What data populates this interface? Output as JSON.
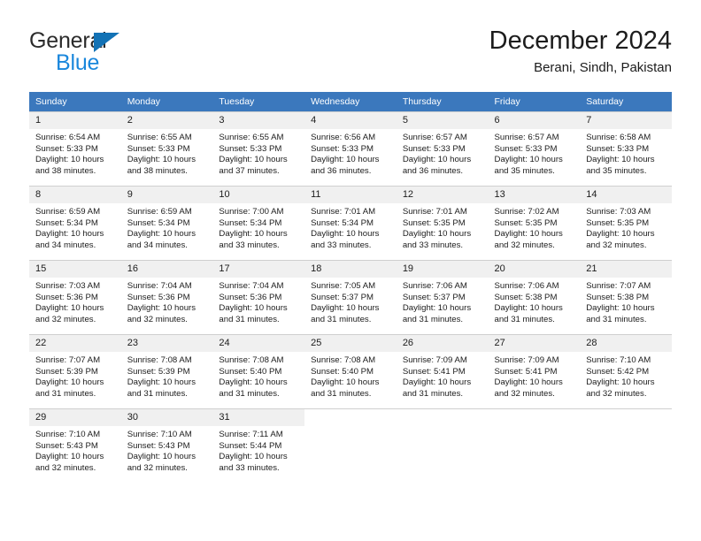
{
  "brand": {
    "name_top": "General",
    "name_bottom": "Blue",
    "triangle_icon": "brand-triangle-icon",
    "accent_color": "#1272b5",
    "blue_text_color": "#1a87dc"
  },
  "header": {
    "title": "December 2024",
    "subtitle": "Berani, Sindh, Pakistan"
  },
  "theme": {
    "header_row_background": "#3b78bd",
    "header_row_text": "#ffffff",
    "daynum_background": "#f0f0f0",
    "cell_border": "#cfcfcf",
    "body_text": "#1c1c1c"
  },
  "weekday_headers": [
    "Sunday",
    "Monday",
    "Tuesday",
    "Wednesday",
    "Thursday",
    "Friday",
    "Saturday"
  ],
  "labels": {
    "sunrise_prefix": "Sunrise:",
    "sunset_prefix": "Sunset:",
    "daylight_prefix": "Daylight:"
  },
  "weeks": [
    [
      {
        "day": "1",
        "sunrise": "Sunrise: 6:54 AM",
        "sunset": "Sunset: 5:33 PM",
        "daylight_1": "Daylight: 10 hours",
        "daylight_2": "and 38 minutes."
      },
      {
        "day": "2",
        "sunrise": "Sunrise: 6:55 AM",
        "sunset": "Sunset: 5:33 PM",
        "daylight_1": "Daylight: 10 hours",
        "daylight_2": "and 38 minutes."
      },
      {
        "day": "3",
        "sunrise": "Sunrise: 6:55 AM",
        "sunset": "Sunset: 5:33 PM",
        "daylight_1": "Daylight: 10 hours",
        "daylight_2": "and 37 minutes."
      },
      {
        "day": "4",
        "sunrise": "Sunrise: 6:56 AM",
        "sunset": "Sunset: 5:33 PM",
        "daylight_1": "Daylight: 10 hours",
        "daylight_2": "and 36 minutes."
      },
      {
        "day": "5",
        "sunrise": "Sunrise: 6:57 AM",
        "sunset": "Sunset: 5:33 PM",
        "daylight_1": "Daylight: 10 hours",
        "daylight_2": "and 36 minutes."
      },
      {
        "day": "6",
        "sunrise": "Sunrise: 6:57 AM",
        "sunset": "Sunset: 5:33 PM",
        "daylight_1": "Daylight: 10 hours",
        "daylight_2": "and 35 minutes."
      },
      {
        "day": "7",
        "sunrise": "Sunrise: 6:58 AM",
        "sunset": "Sunset: 5:33 PM",
        "daylight_1": "Daylight: 10 hours",
        "daylight_2": "and 35 minutes."
      }
    ],
    [
      {
        "day": "8",
        "sunrise": "Sunrise: 6:59 AM",
        "sunset": "Sunset: 5:34 PM",
        "daylight_1": "Daylight: 10 hours",
        "daylight_2": "and 34 minutes."
      },
      {
        "day": "9",
        "sunrise": "Sunrise: 6:59 AM",
        "sunset": "Sunset: 5:34 PM",
        "daylight_1": "Daylight: 10 hours",
        "daylight_2": "and 34 minutes."
      },
      {
        "day": "10",
        "sunrise": "Sunrise: 7:00 AM",
        "sunset": "Sunset: 5:34 PM",
        "daylight_1": "Daylight: 10 hours",
        "daylight_2": "and 33 minutes."
      },
      {
        "day": "11",
        "sunrise": "Sunrise: 7:01 AM",
        "sunset": "Sunset: 5:34 PM",
        "daylight_1": "Daylight: 10 hours",
        "daylight_2": "and 33 minutes."
      },
      {
        "day": "12",
        "sunrise": "Sunrise: 7:01 AM",
        "sunset": "Sunset: 5:35 PM",
        "daylight_1": "Daylight: 10 hours",
        "daylight_2": "and 33 minutes."
      },
      {
        "day": "13",
        "sunrise": "Sunrise: 7:02 AM",
        "sunset": "Sunset: 5:35 PM",
        "daylight_1": "Daylight: 10 hours",
        "daylight_2": "and 32 minutes."
      },
      {
        "day": "14",
        "sunrise": "Sunrise: 7:03 AM",
        "sunset": "Sunset: 5:35 PM",
        "daylight_1": "Daylight: 10 hours",
        "daylight_2": "and 32 minutes."
      }
    ],
    [
      {
        "day": "15",
        "sunrise": "Sunrise: 7:03 AM",
        "sunset": "Sunset: 5:36 PM",
        "daylight_1": "Daylight: 10 hours",
        "daylight_2": "and 32 minutes."
      },
      {
        "day": "16",
        "sunrise": "Sunrise: 7:04 AM",
        "sunset": "Sunset: 5:36 PM",
        "daylight_1": "Daylight: 10 hours",
        "daylight_2": "and 32 minutes."
      },
      {
        "day": "17",
        "sunrise": "Sunrise: 7:04 AM",
        "sunset": "Sunset: 5:36 PM",
        "daylight_1": "Daylight: 10 hours",
        "daylight_2": "and 31 minutes."
      },
      {
        "day": "18",
        "sunrise": "Sunrise: 7:05 AM",
        "sunset": "Sunset: 5:37 PM",
        "daylight_1": "Daylight: 10 hours",
        "daylight_2": "and 31 minutes."
      },
      {
        "day": "19",
        "sunrise": "Sunrise: 7:06 AM",
        "sunset": "Sunset: 5:37 PM",
        "daylight_1": "Daylight: 10 hours",
        "daylight_2": "and 31 minutes."
      },
      {
        "day": "20",
        "sunrise": "Sunrise: 7:06 AM",
        "sunset": "Sunset: 5:38 PM",
        "daylight_1": "Daylight: 10 hours",
        "daylight_2": "and 31 minutes."
      },
      {
        "day": "21",
        "sunrise": "Sunrise: 7:07 AM",
        "sunset": "Sunset: 5:38 PM",
        "daylight_1": "Daylight: 10 hours",
        "daylight_2": "and 31 minutes."
      }
    ],
    [
      {
        "day": "22",
        "sunrise": "Sunrise: 7:07 AM",
        "sunset": "Sunset: 5:39 PM",
        "daylight_1": "Daylight: 10 hours",
        "daylight_2": "and 31 minutes."
      },
      {
        "day": "23",
        "sunrise": "Sunrise: 7:08 AM",
        "sunset": "Sunset: 5:39 PM",
        "daylight_1": "Daylight: 10 hours",
        "daylight_2": "and 31 minutes."
      },
      {
        "day": "24",
        "sunrise": "Sunrise: 7:08 AM",
        "sunset": "Sunset: 5:40 PM",
        "daylight_1": "Daylight: 10 hours",
        "daylight_2": "and 31 minutes."
      },
      {
        "day": "25",
        "sunrise": "Sunrise: 7:08 AM",
        "sunset": "Sunset: 5:40 PM",
        "daylight_1": "Daylight: 10 hours",
        "daylight_2": "and 31 minutes."
      },
      {
        "day": "26",
        "sunrise": "Sunrise: 7:09 AM",
        "sunset": "Sunset: 5:41 PM",
        "daylight_1": "Daylight: 10 hours",
        "daylight_2": "and 31 minutes."
      },
      {
        "day": "27",
        "sunrise": "Sunrise: 7:09 AM",
        "sunset": "Sunset: 5:41 PM",
        "daylight_1": "Daylight: 10 hours",
        "daylight_2": "and 32 minutes."
      },
      {
        "day": "28",
        "sunrise": "Sunrise: 7:10 AM",
        "sunset": "Sunset: 5:42 PM",
        "daylight_1": "Daylight: 10 hours",
        "daylight_2": "and 32 minutes."
      }
    ],
    [
      {
        "day": "29",
        "sunrise": "Sunrise: 7:10 AM",
        "sunset": "Sunset: 5:43 PM",
        "daylight_1": "Daylight: 10 hours",
        "daylight_2": "and 32 minutes."
      },
      {
        "day": "30",
        "sunrise": "Sunrise: 7:10 AM",
        "sunset": "Sunset: 5:43 PM",
        "daylight_1": "Daylight: 10 hours",
        "daylight_2": "and 32 minutes."
      },
      {
        "day": "31",
        "sunrise": "Sunrise: 7:11 AM",
        "sunset": "Sunset: 5:44 PM",
        "daylight_1": "Daylight: 10 hours",
        "daylight_2": "and 33 minutes."
      },
      {
        "day": "",
        "sunrise": "",
        "sunset": "",
        "daylight_1": "",
        "daylight_2": ""
      },
      {
        "day": "",
        "sunrise": "",
        "sunset": "",
        "daylight_1": "",
        "daylight_2": ""
      },
      {
        "day": "",
        "sunrise": "",
        "sunset": "",
        "daylight_1": "",
        "daylight_2": ""
      },
      {
        "day": "",
        "sunrise": "",
        "sunset": "",
        "daylight_1": "",
        "daylight_2": ""
      }
    ]
  ]
}
